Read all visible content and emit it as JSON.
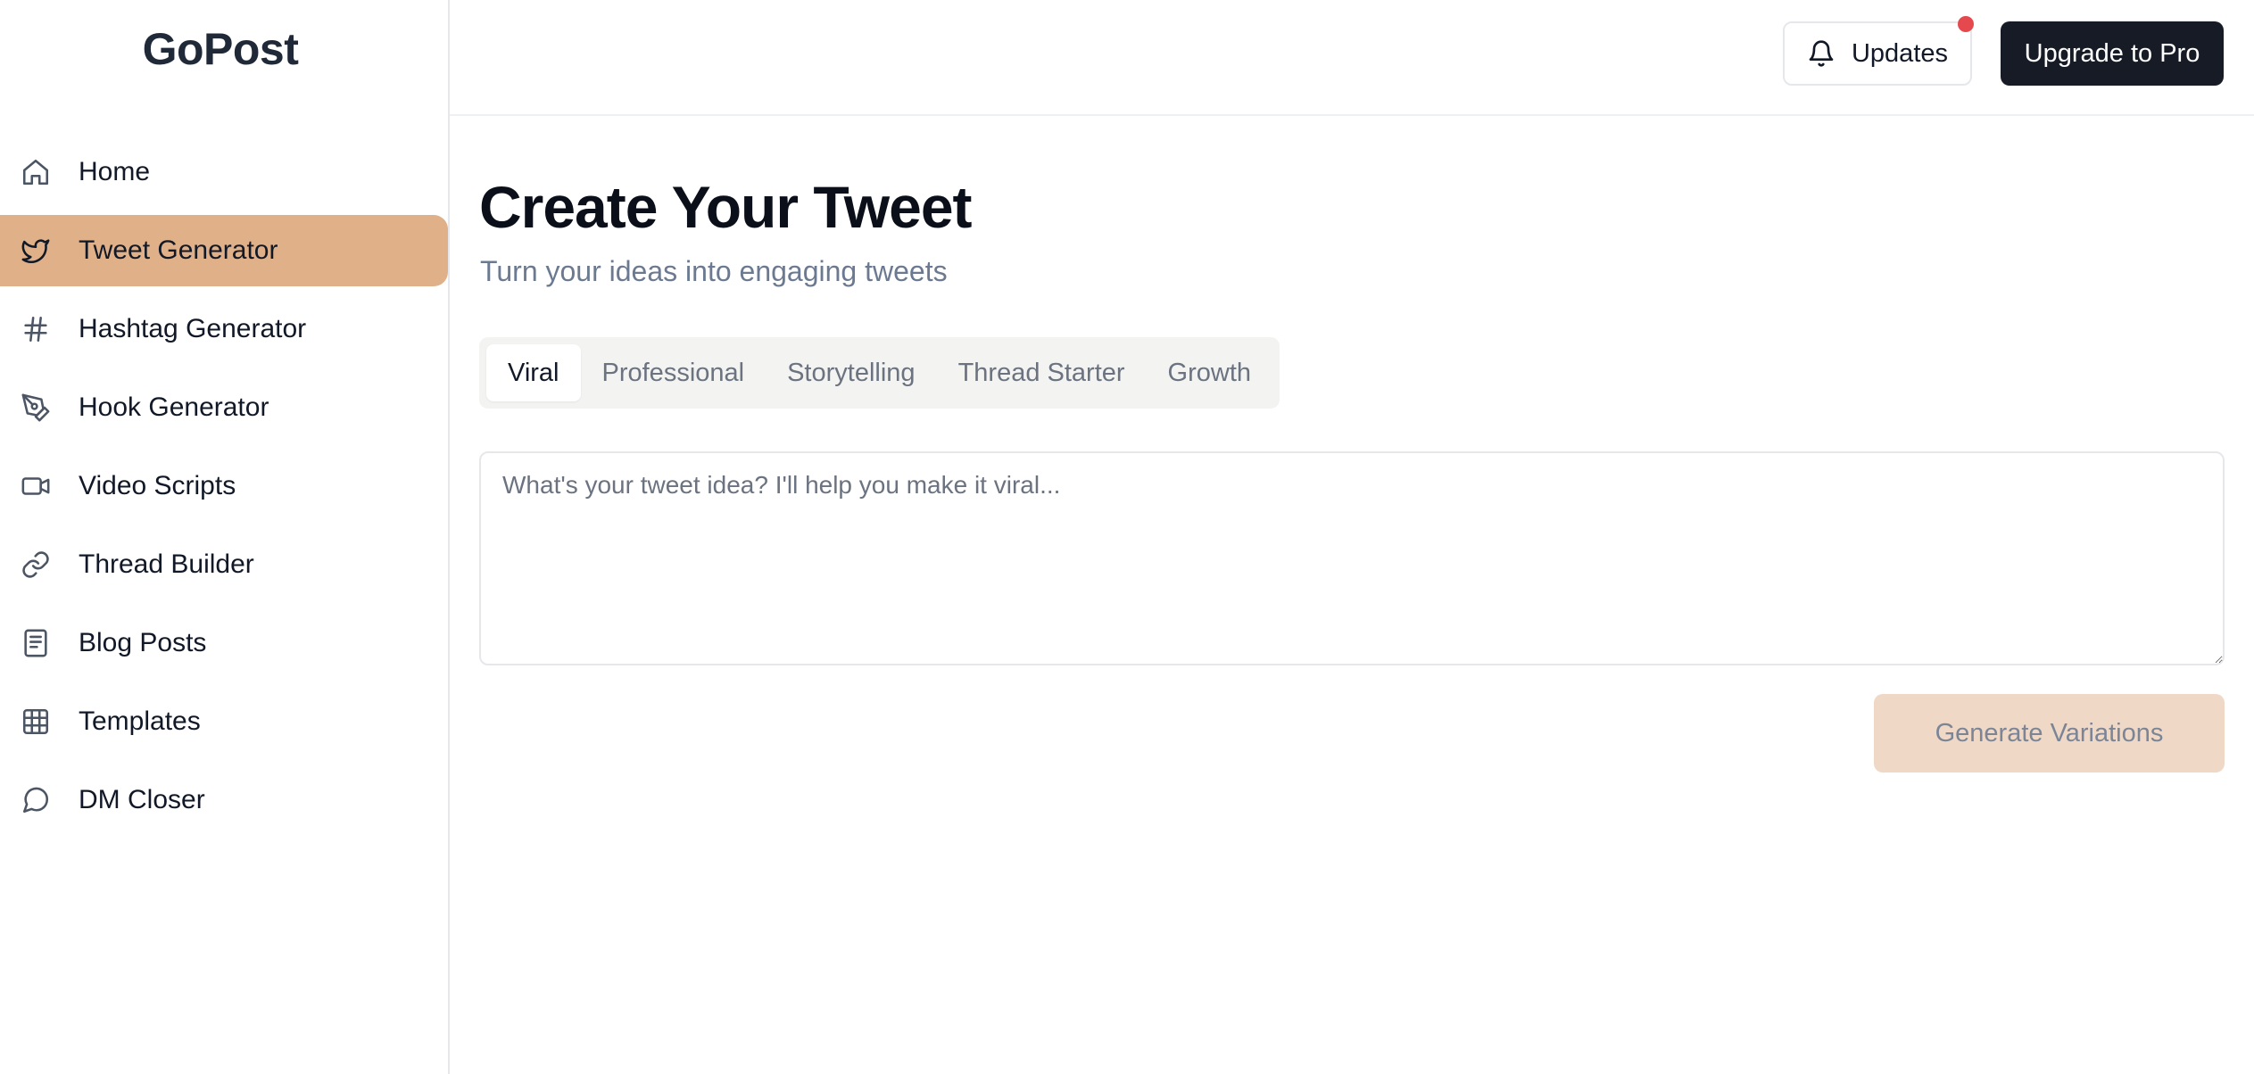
{
  "app": {
    "name": "GoPost"
  },
  "sidebar": {
    "items": [
      {
        "label": "Home",
        "icon": "home-icon",
        "active": false
      },
      {
        "label": "Tweet Generator",
        "icon": "twitter-bird-icon",
        "active": true
      },
      {
        "label": "Hashtag Generator",
        "icon": "hash-icon",
        "active": false
      },
      {
        "label": "Hook Generator",
        "icon": "pen-tool-icon",
        "active": false
      },
      {
        "label": "Video Scripts",
        "icon": "video-icon",
        "active": false
      },
      {
        "label": "Thread Builder",
        "icon": "link-icon",
        "active": false
      },
      {
        "label": "Blog Posts",
        "icon": "document-icon",
        "active": false
      },
      {
        "label": "Templates",
        "icon": "grid-icon",
        "active": false
      },
      {
        "label": "DM Closer",
        "icon": "message-circle-icon",
        "active": false
      }
    ]
  },
  "header": {
    "updates_label": "Updates",
    "upgrade_label": "Upgrade to Pro"
  },
  "main": {
    "title": "Create Your Tweet",
    "subtitle": "Turn your ideas into engaging tweets",
    "tabs": [
      {
        "label": "Viral",
        "active": true
      },
      {
        "label": "Professional",
        "active": false
      },
      {
        "label": "Storytelling",
        "active": false
      },
      {
        "label": "Thread Starter",
        "active": false
      },
      {
        "label": "Growth",
        "active": false
      }
    ],
    "input": {
      "value": "",
      "placeholder": "What's your tweet idea? I'll help you make it viral..."
    },
    "generate_label": "Generate Variations"
  },
  "colors": {
    "accent": "#e0b088",
    "accent_disabled": "#f0d8c6",
    "dark_button": "#171b26",
    "notification_dot": "#e5484d"
  }
}
